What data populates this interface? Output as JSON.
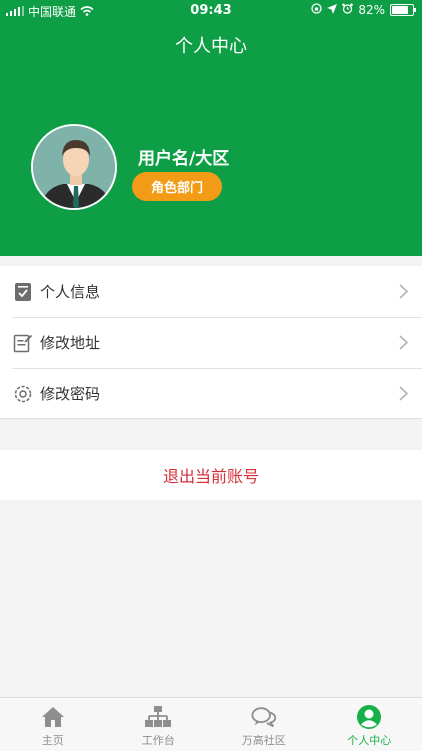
{
  "status_bar": {
    "carrier": "中国联通",
    "time": "09:43",
    "battery": "82%",
    "battery_level": 0.82
  },
  "header": {
    "title": "个人中心"
  },
  "profile": {
    "username": "用户名/大区",
    "role_button": "角色部门"
  },
  "menu": [
    {
      "label": "个人信息",
      "icon": "id-card-icon"
    },
    {
      "label": "修改地址",
      "icon": "edit-note-icon"
    },
    {
      "label": "修改密码",
      "icon": "gear-icon"
    }
  ],
  "logout": {
    "label": "退出当前账号"
  },
  "tabs": [
    {
      "label": "主页",
      "icon": "home-icon",
      "active": false
    },
    {
      "label": "工作台",
      "icon": "org-chart-icon",
      "active": false
    },
    {
      "label": "万高社区",
      "icon": "chat-bubbles-icon",
      "active": false
    },
    {
      "label": "个人中心",
      "icon": "user-circle-icon",
      "active": true
    }
  ],
  "colors": {
    "header_green": "#0e9f46",
    "role_orange": "#f29b16",
    "logout_red": "#d6303a",
    "tab_active": "#17b14a"
  }
}
